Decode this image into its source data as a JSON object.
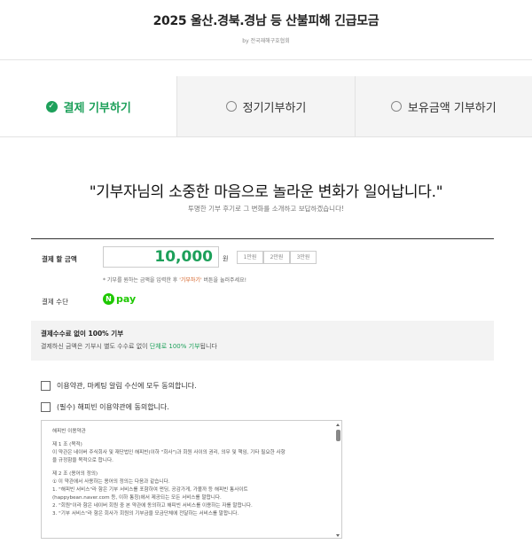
{
  "header": {
    "title": "2025 울산.경북.경남 등 산불피해 긴급모금",
    "by": "by 전국재해구호협회"
  },
  "tabs": [
    {
      "label": "결제 기부하기",
      "active": true
    },
    {
      "label": "정기기부하기",
      "active": false
    },
    {
      "label": "보유금액 기부하기",
      "active": false
    }
  ],
  "headline": "\"기부자님의 소중한 마음으로 놀라운 변화가 일어납니다.\"",
  "subline": "투명한 기부 후기로 그 변화를 소개하고 보답하겠습니다!",
  "amount": {
    "label": "결제 할 금액",
    "value": "10,000",
    "unit": "원",
    "presets": [
      "1만원",
      "2만원",
      "3만원"
    ],
    "hint_prefix": "* 기부를 원하는 금액을 입력한 후 ",
    "hint_emphasis": "'기부하기'",
    "hint_suffix": " 버튼을 눌러주세요!"
  },
  "payment": {
    "label": "결제 수단",
    "method_letter": "N",
    "method_text": "pay"
  },
  "notice": {
    "title": "결제수수료 없이 100% 기부",
    "desc_prefix": "결제하신 금액은 기부시 별도 수수료 없이 ",
    "desc_emphasis": "단체로 100% 기부",
    "desc_suffix": "됩니다"
  },
  "agreements": {
    "all": "이용약관, 마케팅 알림 수신에 모두 동의합니다.",
    "required": "(필수) 해피빈 이용약관에 동의합니다."
  },
  "terms": {
    "title": "해피빈 이용약관",
    "art1_title": "제 1 조 (목적)",
    "art1_line1": "이 약관은 네이버 주식회사 및 재단법인 해피빈(이하 \"회사\")과 회원 사이의 권리, 의무 및 책임, 기타 필요한 사항",
    "art1_line2": "을 규정함을 목적으로 합니다.",
    "art2_title": "제 2 조 (용어의 정의)",
    "art2_line1": "① 이 약관에서 사용하는 용어의 정의는 다음과 같습니다.",
    "art2_line2": "1. \"해피빈 서비스\"라 함은 기부 서비스를 포함하여 펀딩, 공감가게, 가볼까 등 해피빈 통사이트",
    "art2_line3": "(happybean.naver.com 등, 이하 통칭)에서 제공되는 모든 서비스를 말합니다.",
    "art2_line4": "2. \"회원\"이라 함은 네이버 회원 중 본 약관에 동의하고 해피빈 서비스를 이용하는 자를 말합니다.",
    "art2_line5": "3. \"기부 서비스\"라 함은 회사가 회원의 기부금을 모금단체에 전달하는 서비스를 말합니다."
  }
}
